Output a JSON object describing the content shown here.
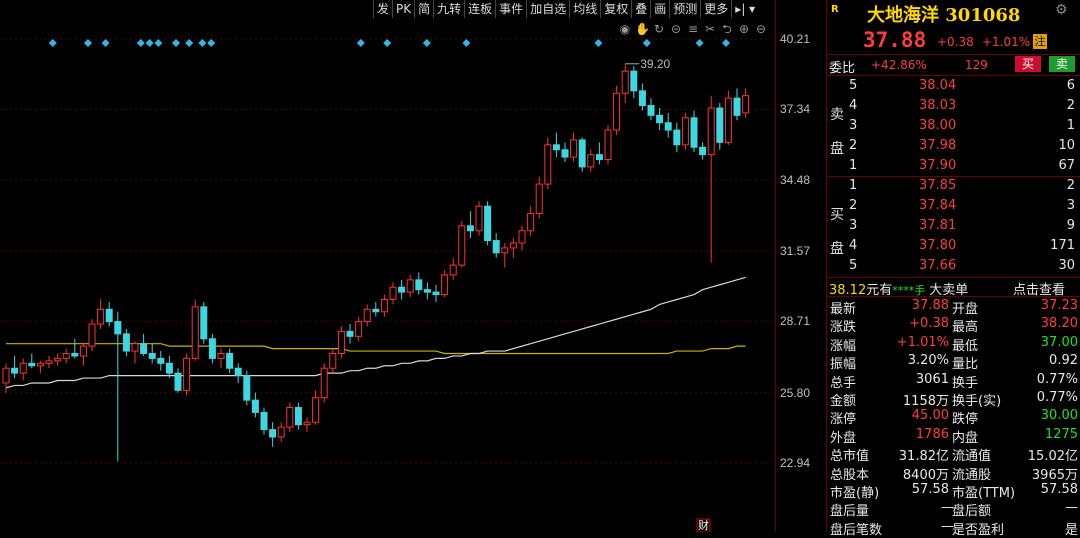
{
  "toolbar": {
    "items": [
      "发",
      "PK",
      "简",
      "九转",
      "连板",
      "事件",
      "加自选",
      "均线",
      "复权",
      "叠",
      "画",
      "预测",
      "更多"
    ]
  },
  "chart_data": {
    "type": "candlestick",
    "y_ticks": [
      "40.21",
      "37.34",
      "34.48",
      "31.57",
      "28.71",
      "25.80",
      "22.94"
    ],
    "ylim": [
      22.94,
      40.21
    ],
    "annotation_high": "39.20",
    "bottom_marker": "财",
    "ohlc": [
      [
        26.2,
        27.0,
        25.8,
        26.8
      ],
      [
        26.8,
        27.3,
        26.4,
        26.6
      ],
      [
        26.6,
        27.2,
        26.3,
        27.0
      ],
      [
        27.0,
        27.4,
        26.8,
        26.9
      ],
      [
        26.9,
        27.1,
        26.6,
        27.0
      ],
      [
        27.0,
        27.3,
        26.8,
        27.1
      ],
      [
        27.1,
        27.4,
        26.9,
        27.2
      ],
      [
        27.2,
        27.6,
        27.0,
        27.4
      ],
      [
        27.4,
        28.0,
        27.2,
        27.3
      ],
      [
        27.3,
        27.8,
        26.9,
        27.7
      ],
      [
        27.7,
        28.8,
        27.5,
        28.6
      ],
      [
        28.6,
        29.6,
        28.4,
        29.2
      ],
      [
        29.2,
        29.5,
        28.5,
        28.7
      ],
      [
        28.7,
        29.1,
        23.0,
        28.2
      ],
      [
        28.2,
        28.4,
        27.3,
        27.5
      ],
      [
        27.5,
        27.9,
        27.0,
        27.8
      ],
      [
        27.8,
        28.2,
        27.3,
        27.4
      ],
      [
        27.4,
        27.8,
        27.0,
        27.2
      ],
      [
        27.2,
        27.5,
        26.7,
        27.0
      ],
      [
        27.0,
        27.3,
        26.4,
        26.6
      ],
      [
        26.6,
        26.8,
        25.8,
        25.9
      ],
      [
        25.9,
        27.4,
        25.7,
        27.2
      ],
      [
        27.2,
        29.6,
        27.1,
        29.3
      ],
      [
        29.3,
        29.5,
        27.8,
        28.0
      ],
      [
        28.0,
        28.2,
        27.0,
        27.2
      ],
      [
        27.2,
        27.6,
        26.8,
        27.4
      ],
      [
        27.4,
        27.6,
        26.6,
        26.8
      ],
      [
        26.8,
        27.0,
        26.2,
        26.5
      ],
      [
        26.5,
        26.7,
        25.3,
        25.5
      ],
      [
        25.5,
        25.8,
        24.8,
        25.0
      ],
      [
        25.0,
        25.2,
        24.1,
        24.3
      ],
      [
        24.3,
        24.6,
        23.6,
        24.0
      ],
      [
        24.0,
        24.6,
        23.8,
        24.4
      ],
      [
        24.4,
        25.4,
        24.2,
        25.2
      ],
      [
        25.2,
        25.4,
        24.3,
        24.5
      ],
      [
        24.5,
        24.8,
        24.2,
        24.6
      ],
      [
        24.6,
        25.9,
        24.5,
        25.6
      ],
      [
        25.6,
        27.0,
        25.4,
        26.8
      ],
      [
        26.8,
        27.6,
        26.6,
        27.4
      ],
      [
        27.4,
        28.5,
        27.2,
        28.3
      ],
      [
        28.3,
        28.6,
        27.8,
        28.1
      ],
      [
        28.1,
        28.9,
        27.9,
        28.7
      ],
      [
        28.7,
        29.4,
        28.5,
        29.2
      ],
      [
        29.2,
        29.5,
        28.9,
        29.1
      ],
      [
        29.1,
        29.8,
        28.9,
        29.6
      ],
      [
        29.6,
        30.3,
        29.4,
        30.1
      ],
      [
        30.1,
        30.4,
        29.6,
        29.9
      ],
      [
        29.9,
        30.6,
        29.7,
        30.4
      ],
      [
        30.4,
        30.7,
        29.8,
        30.0
      ],
      [
        30.0,
        30.3,
        29.6,
        29.9
      ],
      [
        29.9,
        30.2,
        29.5,
        29.8
      ],
      [
        29.8,
        30.8,
        29.7,
        30.6
      ],
      [
        30.6,
        31.3,
        30.4,
        31.0
      ],
      [
        31.0,
        32.8,
        30.9,
        32.6
      ],
      [
        32.6,
        33.2,
        32.1,
        32.4
      ],
      [
        32.4,
        33.6,
        32.2,
        33.4
      ],
      [
        33.4,
        33.6,
        31.8,
        32.0
      ],
      [
        32.0,
        32.3,
        31.3,
        31.5
      ],
      [
        31.5,
        31.9,
        30.9,
        31.7
      ],
      [
        31.7,
        32.1,
        31.3,
        31.9
      ],
      [
        31.9,
        32.6,
        31.6,
        32.4
      ],
      [
        32.4,
        33.4,
        32.2,
        33.1
      ],
      [
        33.1,
        34.6,
        32.9,
        34.3
      ],
      [
        34.3,
        36.2,
        34.1,
        35.9
      ],
      [
        35.9,
        36.4,
        35.4,
        35.7
      ],
      [
        35.7,
        36.0,
        35.2,
        35.4
      ],
      [
        35.4,
        36.4,
        35.2,
        36.1
      ],
      [
        36.1,
        36.2,
        34.8,
        35.0
      ],
      [
        35.0,
        35.7,
        34.8,
        35.5
      ],
      [
        35.5,
        36.0,
        35.1,
        35.3
      ],
      [
        35.3,
        36.7,
        35.1,
        36.5
      ],
      [
        36.5,
        38.3,
        36.3,
        38.0
      ],
      [
        38.0,
        39.2,
        37.6,
        38.9
      ],
      [
        38.9,
        39.1,
        37.8,
        38.1
      ],
      [
        38.1,
        38.4,
        37.3,
        37.5
      ],
      [
        37.5,
        37.8,
        36.9,
        37.1
      ],
      [
        37.1,
        37.4,
        36.5,
        36.8
      ],
      [
        36.8,
        37.2,
        36.2,
        36.5
      ],
      [
        36.5,
        36.8,
        35.6,
        35.9
      ],
      [
        35.9,
        37.2,
        35.7,
        37.0
      ],
      [
        37.0,
        37.3,
        35.6,
        35.8
      ],
      [
        35.8,
        36.0,
        35.3,
        35.5
      ],
      [
        35.5,
        37.9,
        31.1,
        37.4
      ],
      [
        37.4,
        37.6,
        35.7,
        36.0
      ],
      [
        36.0,
        38.1,
        35.9,
        37.8
      ],
      [
        37.8,
        38.2,
        36.9,
        37.1
      ],
      [
        37.2,
        38.2,
        37.0,
        37.9
      ]
    ],
    "ma_white": [
      26.0,
      26.1,
      26.1,
      26.2,
      26.2,
      26.2,
      26.3,
      26.3,
      26.3,
      26.4,
      26.4,
      26.4,
      26.5,
      26.5,
      26.5,
      26.5,
      26.5,
      26.5,
      26.5,
      26.5,
      26.5,
      26.5,
      26.5,
      26.5,
      26.5,
      26.5,
      26.5,
      26.5,
      26.5,
      26.5,
      26.5,
      26.5,
      26.5,
      26.5,
      26.5,
      26.5,
      26.5,
      26.6,
      26.6,
      26.6,
      26.7,
      26.7,
      26.8,
      26.8,
      26.9,
      26.9,
      27.0,
      27.0,
      27.1,
      27.1,
      27.2,
      27.2,
      27.3,
      27.3,
      27.4,
      27.4,
      27.5,
      27.5,
      27.5,
      27.6,
      27.7,
      27.8,
      27.9,
      28.0,
      28.1,
      28.2,
      28.3,
      28.4,
      28.5,
      28.6,
      28.7,
      28.8,
      28.9,
      29.0,
      29.1,
      29.2,
      29.4,
      29.5,
      29.6,
      29.7,
      29.8,
      30.0,
      30.1,
      30.2,
      30.3,
      30.4,
      30.5
    ],
    "ma_yellow": [
      27.8,
      27.8,
      27.8,
      27.8,
      27.8,
      27.8,
      27.8,
      27.8,
      27.8,
      27.8,
      27.8,
      27.8,
      27.8,
      27.8,
      27.8,
      27.8,
      27.8,
      27.8,
      27.8,
      27.7,
      27.7,
      27.7,
      27.7,
      27.7,
      27.7,
      27.7,
      27.7,
      27.7,
      27.7,
      27.7,
      27.7,
      27.6,
      27.6,
      27.6,
      27.6,
      27.6,
      27.6,
      27.6,
      27.6,
      27.6,
      27.5,
      27.5,
      27.5,
      27.5,
      27.5,
      27.5,
      27.5,
      27.5,
      27.5,
      27.5,
      27.5,
      27.4,
      27.4,
      27.4,
      27.4,
      27.4,
      27.4,
      27.4,
      27.4,
      27.4,
      27.4,
      27.4,
      27.4,
      27.4,
      27.4,
      27.4,
      27.4,
      27.4,
      27.4,
      27.4,
      27.4,
      27.4,
      27.4,
      27.4,
      27.4,
      27.4,
      27.4,
      27.4,
      27.5,
      27.5,
      27.5,
      27.5,
      27.6,
      27.6,
      27.6,
      27.7,
      27.7
    ],
    "diamond_markers": [
      12,
      20,
      24,
      32,
      34,
      36,
      40,
      43,
      46,
      48,
      82,
      88,
      97,
      106,
      136,
      147,
      159,
      165
    ]
  },
  "panel": {
    "logo": "R",
    "name": "大地海洋 301068",
    "price": "37.88",
    "change": "+0.38",
    "change_pct": "+1.01%",
    "badge": "注",
    "weibi_label": "委比",
    "weibi": "+42.86%",
    "weicha": "129",
    "buy_label": "买",
    "sell_label": "卖",
    "sell_side": [
      "卖",
      "盘"
    ],
    "buy_side": [
      "买",
      "盘"
    ],
    "asks": [
      {
        "lv": "5",
        "p": "38.04",
        "v": "6"
      },
      {
        "lv": "4",
        "p": "38.03",
        "v": "2"
      },
      {
        "lv": "3",
        "p": "38.00",
        "v": "1"
      },
      {
        "lv": "2",
        "p": "37.98",
        "v": "10"
      },
      {
        "lv": "1",
        "p": "37.90",
        "v": "67"
      }
    ],
    "bids": [
      {
        "lv": "1",
        "p": "37.85",
        "v": "2"
      },
      {
        "lv": "2",
        "p": "37.84",
        "v": "3"
      },
      {
        "lv": "3",
        "p": "37.81",
        "v": "9"
      },
      {
        "lv": "4",
        "p": "37.80",
        "v": "171"
      },
      {
        "lv": "5",
        "p": "37.66",
        "v": "30"
      }
    ],
    "bigorder": {
      "price": "38.12",
      "text1": "元有",
      "stars": "****手",
      "text2": "大卖单",
      "link": "点击查看"
    },
    "stats": [
      {
        "l1": "最新",
        "v1": "37.88",
        "c1": "red",
        "l2": "开盘",
        "v2": "37.23",
        "c2": "red"
      },
      {
        "l1": "涨跌",
        "v1": "+0.38",
        "c1": "red",
        "l2": "最高",
        "v2": "38.20",
        "c2": "red"
      },
      {
        "l1": "涨幅",
        "v1": "+1.01%",
        "c1": "red",
        "l2": "最低",
        "v2": "37.00",
        "c2": "green"
      },
      {
        "l1": "振幅",
        "v1": "3.20%",
        "c1": "white",
        "l2": "量比",
        "v2": "0.92",
        "c2": "white"
      },
      {
        "l1": "总手",
        "v1": "3061",
        "c1": "white",
        "l2": "换手",
        "v2": "0.77%",
        "c2": "white"
      },
      {
        "l1": "金额",
        "v1": "1158万",
        "c1": "white",
        "l2": "换手(实)",
        "v2": "0.77%",
        "c2": "white"
      },
      {
        "l1": "涨停",
        "v1": "45.00",
        "c1": "red",
        "l2": "跌停",
        "v2": "30.00",
        "c2": "green"
      },
      {
        "l1": "外盘",
        "v1": "1786",
        "c1": "red",
        "l2": "内盘",
        "v2": "1275",
        "c2": "green"
      },
      {
        "l1": "总市值",
        "v1": "31.82亿",
        "c1": "white",
        "l2": "流通值",
        "v2": "15.02亿",
        "c2": "white"
      },
      {
        "l1": "总股本",
        "v1": "8400万",
        "c1": "white",
        "l2": "流通股",
        "v2": "3965万",
        "c2": "white"
      },
      {
        "l1": "市盈(静)",
        "v1": "57.58",
        "c1": "white",
        "l2": "市盈(TTM)",
        "v2": "57.58",
        "c2": "white"
      },
      {
        "l1": "盘后量",
        "v1": "",
        "c1": "white",
        "l2": "盘后额",
        "v2": "",
        "c2": "white"
      },
      {
        "l1": "盘后笔数",
        "v1": "",
        "c1": "white",
        "l2": "是否盈利",
        "v2": "是",
        "c2": "white"
      }
    ]
  }
}
